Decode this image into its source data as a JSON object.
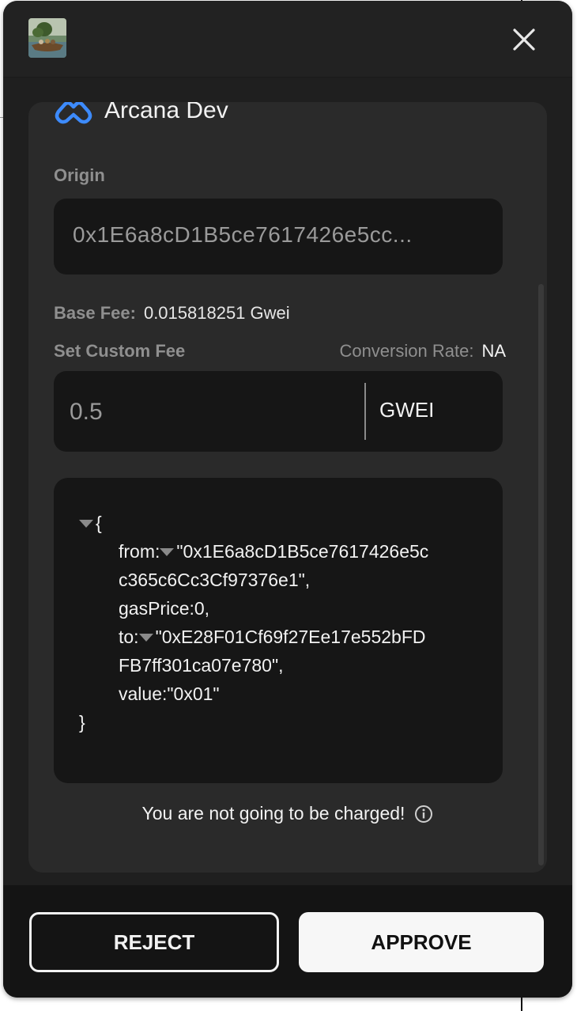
{
  "header": {
    "app_thumbnail": "app-thumbnail-image",
    "close_icon": "close-icon"
  },
  "brand": {
    "name": "Arcana Dev",
    "logo": "arcana-logo-icon",
    "accent": "#3d8bfd"
  },
  "origin": {
    "label": "Origin",
    "value": "0x1E6a8cD1B5ce7617426e5cc..."
  },
  "fees": {
    "base_fee_label": "Base Fee:",
    "base_fee_value": "0.015818251 Gwei",
    "custom_fee_label": "Set Custom Fee",
    "conversion_rate_label": "Conversion Rate:",
    "conversion_rate_value": "NA",
    "custom_fee_value": "0.5",
    "unit": "GWEI"
  },
  "transaction": {
    "open_brace": "{",
    "from_key": "from:",
    "from_line1": "\"0x1E6a8cD1B5ce7617426e5c",
    "from_line2": "c365c6Cc3Cf97376e1\",",
    "gas_price": "gasPrice:0,",
    "to_key": "to:",
    "to_line1": "\"0xE28F01Cf69f27Ee17e552bFD",
    "to_line2": "FB7ff301ca07e780\",",
    "value": "value:\"0x01\"",
    "close_brace": "}"
  },
  "notice": {
    "text": "You are not going to be charged!",
    "icon": "info-icon"
  },
  "actions": {
    "reject_label": "REJECT",
    "approve_label": "APPROVE"
  }
}
